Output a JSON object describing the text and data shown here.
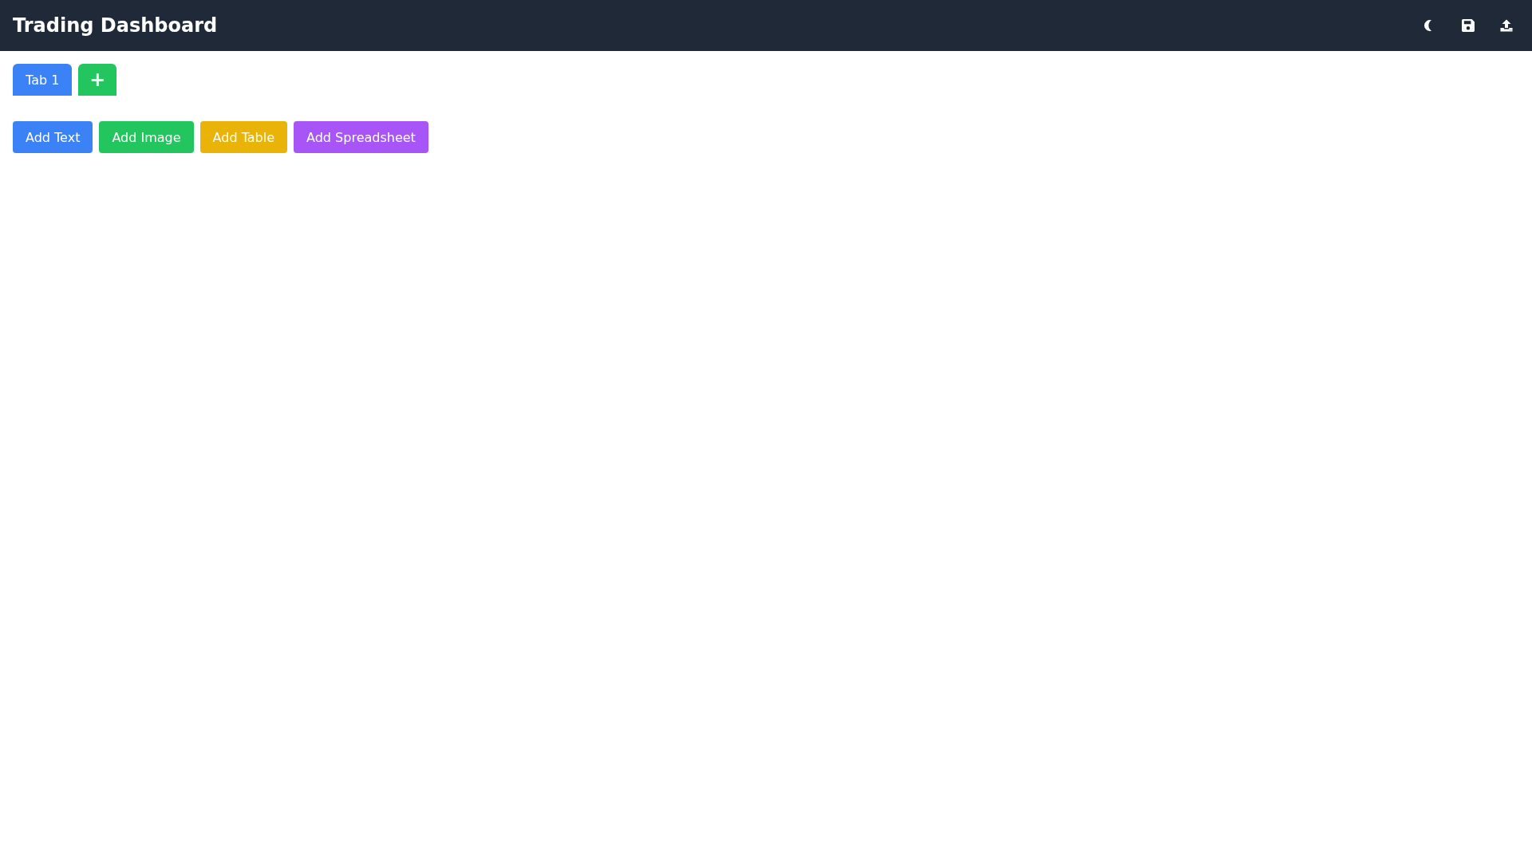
{
  "header": {
    "title": "Trading Dashboard"
  },
  "tabs": [
    {
      "label": "Tab 1",
      "selected": true
    }
  ],
  "add_tab": "+",
  "toolbar": [
    {
      "label": "Add Text",
      "color": "#3b82f6"
    },
    {
      "label": "Add Image",
      "color": "#22c55e"
    },
    {
      "label": "Add Table",
      "color": "#eab308"
    },
    {
      "label": "Add Spreadsheet",
      "color": "#a855f7"
    }
  ]
}
